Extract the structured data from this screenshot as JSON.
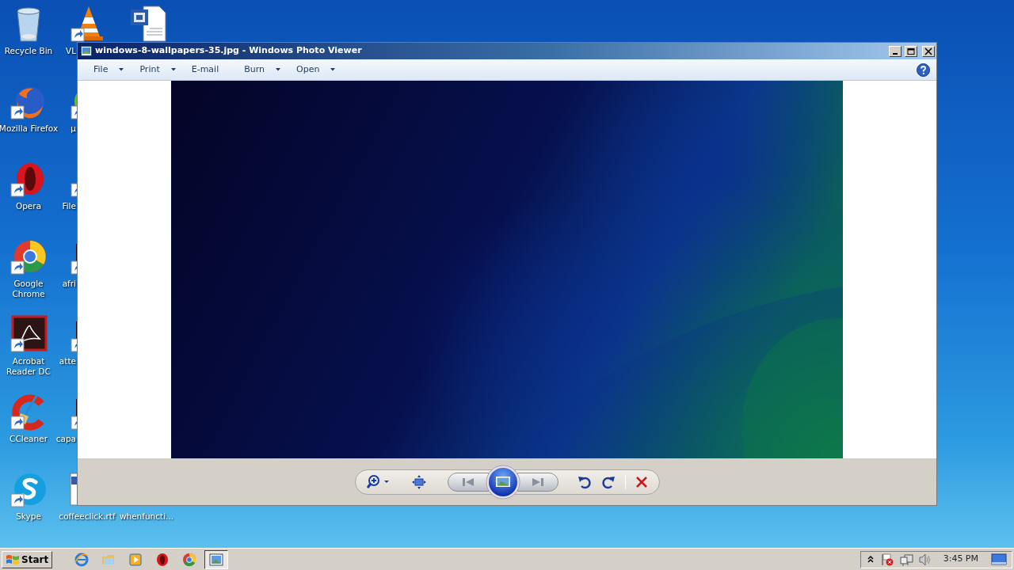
{
  "desktop_icons": [
    {
      "label": "Recycle Bin",
      "kind": "recycle"
    },
    {
      "label": "Mozilla Firefox",
      "kind": "firefox"
    },
    {
      "label": "Opera",
      "kind": "opera"
    },
    {
      "label": "Google Chrome",
      "kind": "chrome"
    },
    {
      "label": "Acrobat Reader DC",
      "kind": "acrobat"
    },
    {
      "label": "CCleaner",
      "kind": "ccleaner"
    },
    {
      "label": "Skype",
      "kind": "skype"
    },
    {
      "label": "VL",
      "kind": "vlc"
    },
    {
      "label": "µ",
      "kind": "utorrent"
    },
    {
      "label": "File",
      "kind": "redfile"
    },
    {
      "label": "afri",
      "kind": "darkfile"
    },
    {
      "label": "atte",
      "kind": "darkfile"
    },
    {
      "label": "capa",
      "kind": "darkfile"
    },
    {
      "label": "coffeeclick.rtf",
      "kind": "doc"
    },
    {
      "kind": "word"
    },
    {
      "label": "whenfuncti..."
    }
  ],
  "window": {
    "title": "windows-8-wallpapers-35.jpg - Windows Photo Viewer",
    "menu": [
      {
        "label": "File",
        "dropdown": true
      },
      {
        "label": "Print",
        "dropdown": true
      },
      {
        "label": "E-mail",
        "dropdown": false
      },
      {
        "label": "Burn",
        "dropdown": true
      },
      {
        "label": "Open",
        "dropdown": true
      }
    ],
    "toolbar": [
      {
        "kind": "zoom"
      },
      {
        "kind": "fit"
      },
      {
        "kind": "prev"
      },
      {
        "kind": "slideshow"
      },
      {
        "kind": "next"
      },
      {
        "kind": "rotate-left"
      },
      {
        "kind": "rotate-right"
      },
      {
        "kind": "delete"
      }
    ]
  },
  "taskbar": {
    "start": "Start",
    "items": [
      {
        "kind": "ie",
        "selected": false
      },
      {
        "kind": "folder",
        "selected": false
      },
      {
        "kind": "media",
        "selected": false
      },
      {
        "kind": "opera",
        "selected": false
      },
      {
        "kind": "chrome",
        "selected": false
      },
      {
        "kind": "photos",
        "selected": true
      }
    ],
    "tray": [
      {
        "kind": "chevron"
      },
      {
        "kind": "flag"
      },
      {
        "kind": "network"
      },
      {
        "kind": "speaker"
      }
    ],
    "clock": "3:45 PM"
  }
}
